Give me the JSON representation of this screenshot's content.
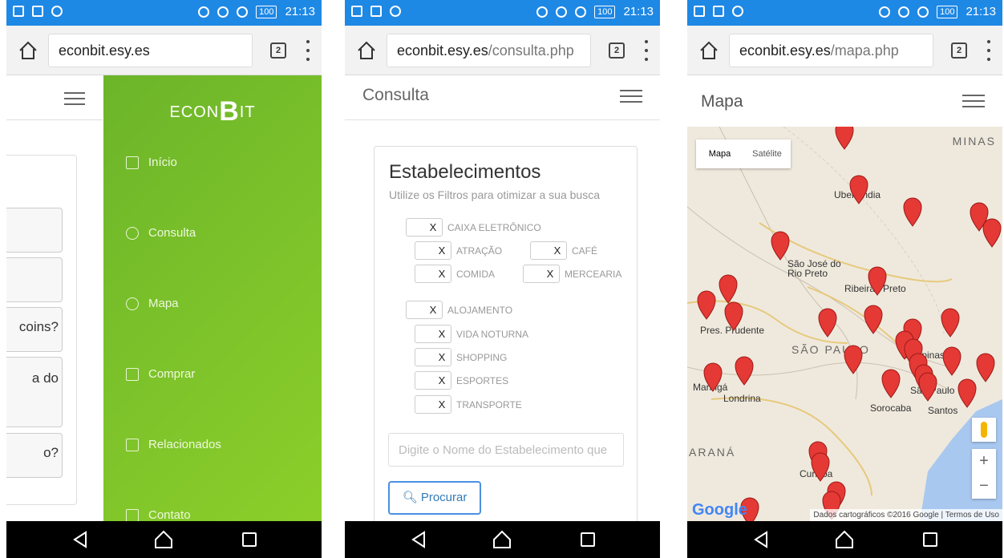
{
  "status": {
    "time": "21:13",
    "battery": "100"
  },
  "screen1": {
    "url": "econbit.esy.es",
    "tab_count": "2",
    "logo": {
      "left": "ECON",
      "mark": "B",
      "right": "IT"
    },
    "menu": [
      "Início",
      "Consulta",
      "Mapa",
      "Comprar",
      "Relacionados",
      "Contato"
    ],
    "partial_buttons": [
      "",
      "",
      "coins?",
      "a do",
      "o?"
    ]
  },
  "screen2": {
    "url_host": "econbit.esy.es",
    "url_path": "/consulta.php",
    "tab_count": "2",
    "title": "Consulta",
    "card_title": "Estabelecimentos",
    "card_subtitle": "Utilize os Filtros para otimizar a sua busca",
    "toggle_mark": "X",
    "filters": {
      "caixa": "CAIXA ELETRÔNICO",
      "atracao": "ATRAÇÃO",
      "cafe": "CAFÉ",
      "comida": "COMIDA",
      "mercearia": "MERCEARIA",
      "alojamento": "ALOJAMENTO",
      "vida_noturna": "VIDA NOTURNA",
      "shopping": "SHOPPING",
      "esportes": "ESPORTES",
      "transporte": "TRANSPORTE"
    },
    "search_placeholder": "Digite o Nome do Estabelecimento que",
    "search_button": "Procurar"
  },
  "screen3": {
    "url_host": "econbit.esy.es",
    "url_path": "/mapa.php",
    "tab_count": "2",
    "title": "Mapa",
    "map_types": [
      "Mapa",
      "Satélite"
    ],
    "states": {
      "minas": "MINAS",
      "sao_paulo": "SÃO PAULO",
      "parana": "ARANÁ"
    },
    "cities": {
      "uberlandia": "Uberlândia",
      "sjrp": "São José do\nRio Preto",
      "ribeirao": "Ribeirão Preto",
      "prudente": "Pres. Prudente",
      "maringa": "Maringá",
      "londrina": "Londrina",
      "campinas": "Campinas",
      "saopaulo": "São Paulo",
      "sorocaba": "Sorocaba",
      "santos": "Santos",
      "curitiba": "Curitiba"
    },
    "zoom_in": "+",
    "zoom_out": "−",
    "google": "Google",
    "attribution": "Dados cartográficos ©2016 Google | Termos de Uso"
  },
  "colors": {
    "status_bar": "#1e88e5",
    "drawer": "#7cc22a",
    "marker": "#e53935",
    "link": "#337ab7"
  }
}
